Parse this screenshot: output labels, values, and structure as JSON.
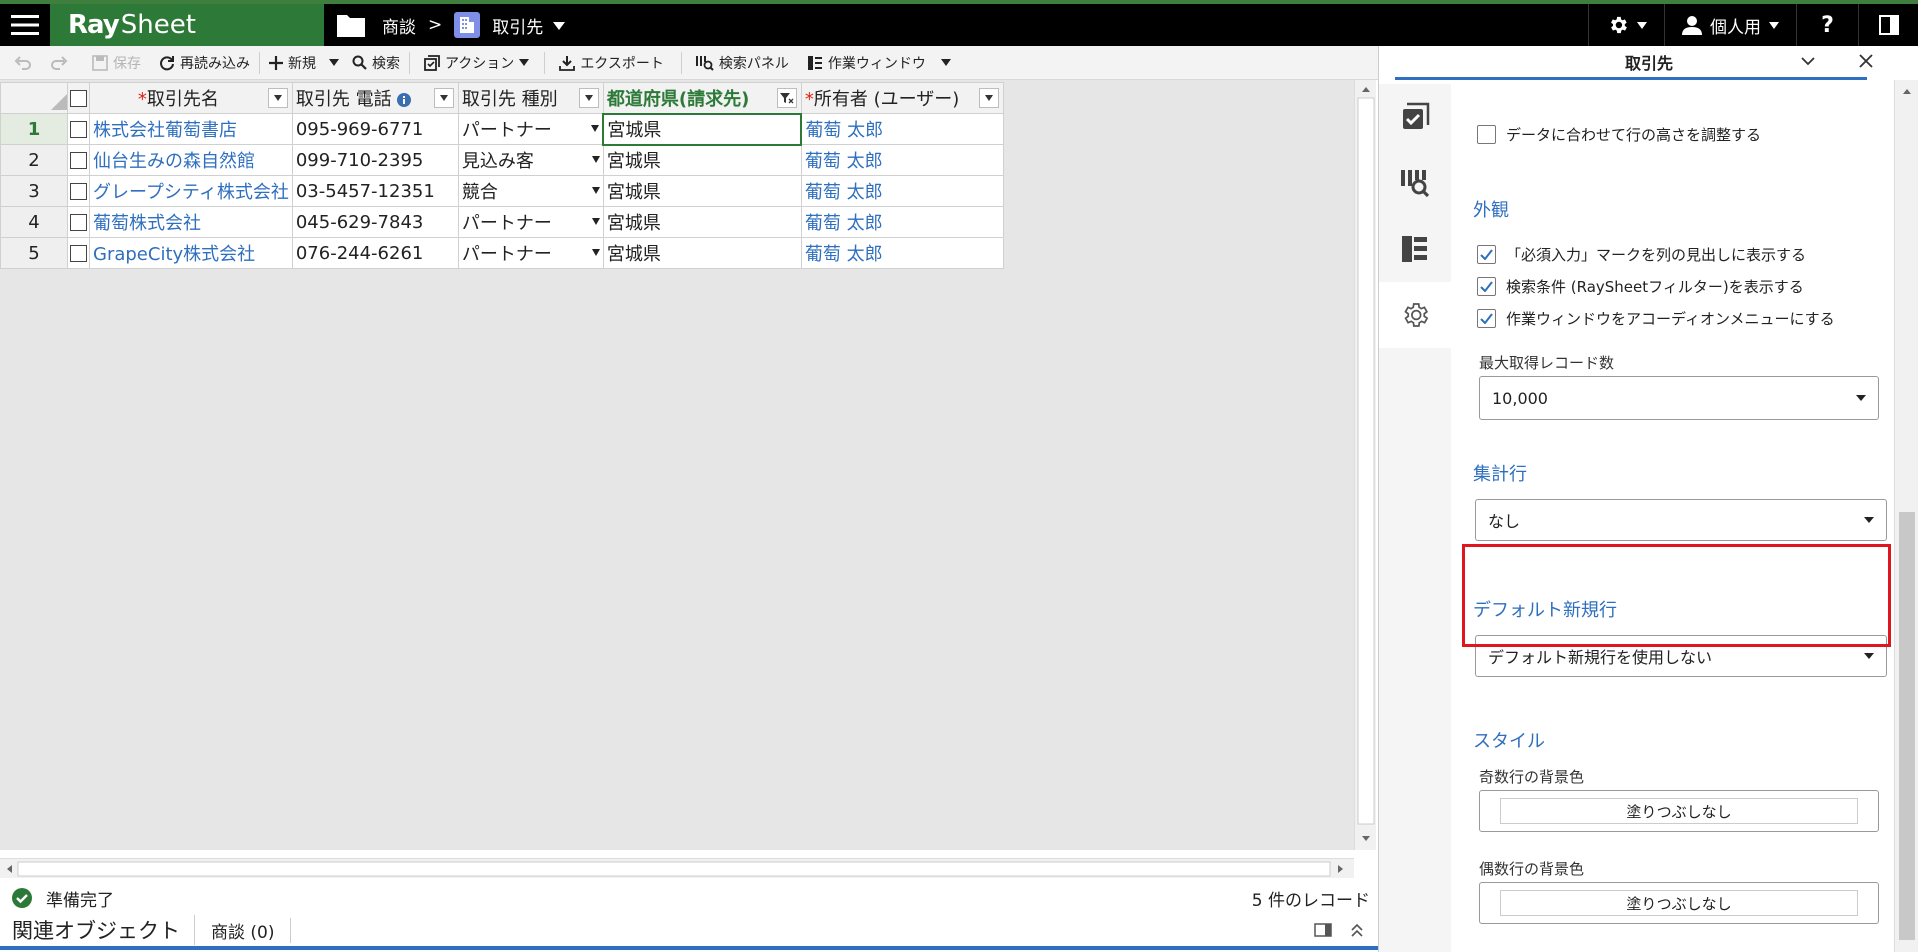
{
  "app": {
    "logo_bold": "Ray",
    "logo_light": "Sheet",
    "breadcrumb": [
      "商談",
      "取引先"
    ],
    "breadcrumb_sep": ">",
    "user_label": "個人用",
    "help": "?"
  },
  "toolbar": {
    "undo": "",
    "redo": "",
    "save": "保存",
    "reload": "再読み込み",
    "new": "新規",
    "search": "検索",
    "action": "アクション",
    "export": "エクスポート",
    "search_panel": "検索パネル",
    "work_window": "作業ウィンドウ"
  },
  "grid": {
    "columns": [
      {
        "label": "取引先名",
        "required": true
      },
      {
        "label": "取引先 電話",
        "info": true
      },
      {
        "label": "取引先 種別"
      },
      {
        "label": "都道府県(請求先)",
        "filtered": true
      },
      {
        "label": "所有者 (ユーザー)",
        "required": true
      }
    ],
    "rows": [
      {
        "no": "1",
        "name": "株式会社葡萄書店",
        "phone": "095-969-6771",
        "type": "パートナー",
        "pref": "宮城県",
        "owner": "葡萄 太郎"
      },
      {
        "no": "2",
        "name": "仙台生みの森自然館",
        "phone": "099-710-2395",
        "type": "見込み客",
        "pref": "宮城県",
        "owner": "葡萄 太郎"
      },
      {
        "no": "3",
        "name": "グレープシティ株式会社",
        "phone": "03-5457-12351",
        "type": "競合",
        "pref": "宮城県",
        "owner": "葡萄 太郎"
      },
      {
        "no": "4",
        "name": "葡萄株式会社",
        "phone": "045-629-7843",
        "type": "パートナー",
        "pref": "宮城県",
        "owner": "葡萄 太郎"
      },
      {
        "no": "5",
        "name": "GrapeCity株式会社",
        "phone": "076-244-6261",
        "type": "パートナー",
        "pref": "宮城県",
        "owner": "葡萄 太郎"
      }
    ]
  },
  "status": {
    "ready": "準備完了",
    "count": "5 件のレコード",
    "related": "関連オブジェクト",
    "related_tab": "商談 (0)"
  },
  "panel": {
    "title": "取引先",
    "adjust_height": "データに合わせて行の高さを調整する",
    "appearance_title": "外観",
    "opt_required_mark": "「必須入力」マークを列の見出しに表示する",
    "opt_search_cond": "検索条件 (RaySheetフィルター)を表示する",
    "opt_accordion": "作業ウィンドウをアコーディオンメニューにする",
    "max_records_label": "最大取得レコード数",
    "max_records_value": "10,000",
    "summary_title": "集計行",
    "summary_value": "なし",
    "default_new_title": "デフォルト新規行",
    "default_new_value": "デフォルト新規行を使用しない",
    "style_title": "スタイル",
    "odd_bg_label": "奇数行の背景色",
    "odd_bg_value": "塗りつぶしなし",
    "even_bg_label": "偶数行の背景色",
    "even_bg_value": "塗りつぶしなし"
  },
  "colors": {
    "brand_green": "#2d7a38",
    "link_blue": "#2f6fbf",
    "highlight_red": "#e0161e"
  }
}
